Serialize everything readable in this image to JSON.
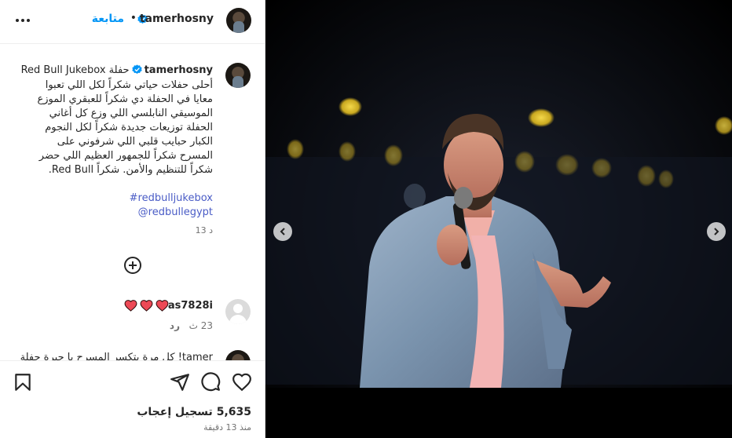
{
  "header": {
    "username": "tamerhosny",
    "follow_label": "متابعة",
    "separator": "•"
  },
  "caption": {
    "username": "tamerhosny",
    "title": "حفلة Red Bull Jukebox",
    "lines": [
      "أحلى حفلات حياتي شكراً لكل اللي تعبوا",
      "معايا في الحفلة دي شكراً للعبقري الموزع",
      "الموسيقي النابلسي اللي وزع كل أغاني",
      "الحفلة توزيعات جديدة شكراً لكل النجوم",
      "الكبار حبايب قلبي اللي شرفوني على",
      "المسرح شكراً للجمهور العظيم اللي حضر",
      "شكراً للتنظيم والأمن. شكراً Red Bull."
    ],
    "hashtag": "#redbulljukebox",
    "mention": "@redbullegypt",
    "time": "13 د"
  },
  "comments": [
    {
      "username": "as7828i",
      "emoji": "❤️❤️❤️",
      "time": "23 ث",
      "reply_label": "رد"
    },
    {
      "username": "tamer",
      "text": "tamer! كل مرة بتكسر المسرح يا جبرة حفلة"
    }
  ],
  "actions": {
    "likes": "5,635 تسجيل إعجاب",
    "ago": "منذ 13 دقيقة"
  },
  "icons": {
    "more": "more-horizontal-icon",
    "verified": "verified-badge-icon",
    "add": "add-circle-icon",
    "heart": "heart-icon",
    "comment": "comment-icon",
    "share": "share-icon",
    "save": "bookmark-icon",
    "prev": "chevron-left-icon",
    "next": "chevron-right-icon"
  },
  "colors": {
    "link": "#0095f6",
    "verified": "#0095f6",
    "heart": "#ed4956"
  }
}
